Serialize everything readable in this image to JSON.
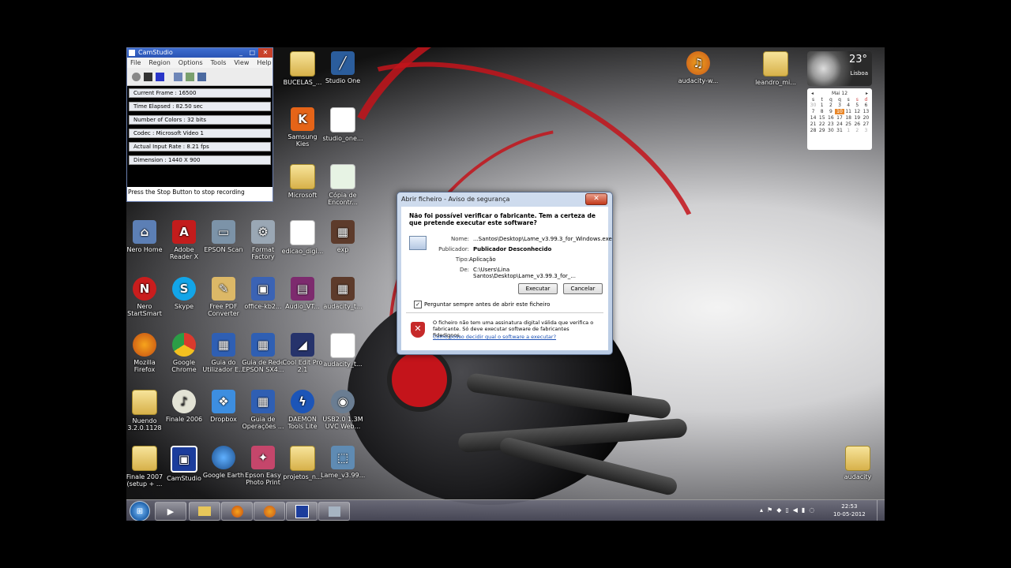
{
  "camstudio": {
    "title": "CamStudio",
    "menu": [
      "File",
      "Region",
      "Options",
      "Tools",
      "View",
      "Help"
    ],
    "stats": [
      "Current Frame : 16500",
      "Time Elapsed : 82.50 sec",
      "Number of Colors : 32 bits",
      "Codec : Microsoft Video 1",
      "Actual Input Rate : 8.21 fps",
      "Dimension : 1440 X 900"
    ],
    "status": "Press the Stop Button to stop recording"
  },
  "icons": [
    {
      "label": "BUCELAS_...",
      "kind": "folder"
    },
    {
      "label": "Studio One",
      "kind": "app"
    },
    {
      "label": "Samsung Kies",
      "kind": "app"
    },
    {
      "label": "studio_one...",
      "kind": "doc"
    },
    {
      "label": "Microsoft",
      "kind": "folder"
    },
    {
      "label": "Cópia de Encontr...",
      "kind": "doc"
    },
    {
      "label": "Nero Home",
      "kind": "app"
    },
    {
      "label": "Adobe Reader X",
      "kind": "app"
    },
    {
      "label": "EPSON Scan",
      "kind": "app"
    },
    {
      "label": "Format Factory",
      "kind": "app"
    },
    {
      "label": "edicao_digi...",
      "kind": "doc"
    },
    {
      "label": "exp",
      "kind": "app"
    },
    {
      "label": "Nero StartSmart",
      "kind": "app"
    },
    {
      "label": "Skype",
      "kind": "app"
    },
    {
      "label": "Free PDF Converter",
      "kind": "app"
    },
    {
      "label": "office-kb2...",
      "kind": "app"
    },
    {
      "label": "Audio_VT...",
      "kind": "app"
    },
    {
      "label": "audacity_t...",
      "kind": "app"
    },
    {
      "label": "Mozilla Firefox",
      "kind": "app"
    },
    {
      "label": "Google Chrome",
      "kind": "app"
    },
    {
      "label": "Guia do Utilizador E...",
      "kind": "app"
    },
    {
      "label": "Guia de Rede EPSON SX4...",
      "kind": "app"
    },
    {
      "label": "Cool Edit Pro 2.1",
      "kind": "app"
    },
    {
      "label": "audacity_t...",
      "kind": "doc"
    },
    {
      "label": "Nuendo 3.2.0.1128",
      "kind": "folder"
    },
    {
      "label": "Finale 2006",
      "kind": "app"
    },
    {
      "label": "Dropbox",
      "kind": "app"
    },
    {
      "label": "Guia de Operações ...",
      "kind": "app"
    },
    {
      "label": "DAEMON Tools Lite",
      "kind": "app"
    },
    {
      "label": "USB2.0 1.3M UVC Web...",
      "kind": "app"
    },
    {
      "label": "Finale 2007 (setup + ...",
      "kind": "folder"
    },
    {
      "label": "CamStudio",
      "kind": "app"
    },
    {
      "label": "Google Earth",
      "kind": "app"
    },
    {
      "label": "Epson Easy Photo Print",
      "kind": "app"
    },
    {
      "label": "projetos_n...",
      "kind": "folder"
    },
    {
      "label": "Lame_v3.99...",
      "kind": "app"
    },
    {
      "label": "audacity-w...",
      "kind": "app"
    },
    {
      "label": "leandro_mi...",
      "kind": "folder"
    },
    {
      "label": "audacity",
      "kind": "folder"
    }
  ],
  "dialog": {
    "title": "Abrir ficheiro - Aviso de segurança",
    "question": "Não foi possível verificar o fabricante. Tem a certeza de que pretende executar este software?",
    "name_label": "Nome:",
    "name_value": "...Santos\\Desktop\\Lame_v3.99.3_for_Windows.exe",
    "publisher_label": "Publicador:",
    "publisher_value": "Publicador Desconhecido",
    "type_label": "Tipo:",
    "type_value": "Aplicação",
    "from_label": "De:",
    "from_value": "C:\\Users\\Lina Santos\\Desktop\\Lame_v3.99.3_for_...",
    "run": "Executar",
    "cancel": "Cancelar",
    "checkbox": "Perguntar sempre antes de abrir este ficheiro",
    "checked": true,
    "warning": "O ficheiro não tem uma assinatura digital válida que verifica o fabricante. Só deve executar software de fabricantes fidedignos.",
    "link": "Como posso decidir qual o software a executar?"
  },
  "weather": {
    "temp": "23°",
    "city": "Lisboa"
  },
  "calendar": {
    "month": "Mai 12",
    "weekdays": [
      "s",
      "t",
      "q",
      "q",
      "s",
      "s",
      "d"
    ],
    "days": [
      "30",
      "1",
      "2",
      "3",
      "4",
      "5",
      "6",
      "7",
      "8",
      "9",
      "10",
      "11",
      "12",
      "13",
      "14",
      "15",
      "16",
      "17",
      "18",
      "19",
      "20",
      "21",
      "22",
      "23",
      "24",
      "25",
      "26",
      "27",
      "28",
      "29",
      "30",
      "31",
      "1",
      "2",
      "3"
    ],
    "today": "10"
  },
  "clock": {
    "time": "22:53",
    "date": "10-05-2012"
  }
}
